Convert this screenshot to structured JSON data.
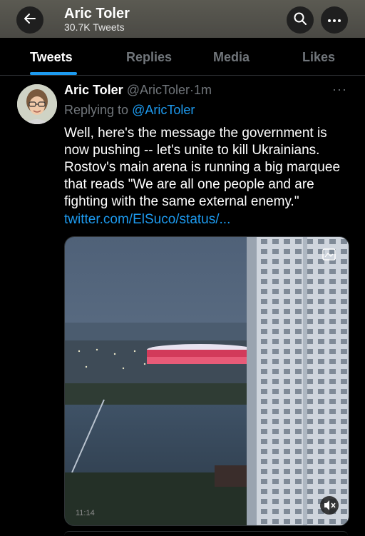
{
  "header": {
    "name": "Aric Toler",
    "count": "30.7K Tweets",
    "back_icon": "arrow-left-icon",
    "search_icon": "search-icon",
    "more_icon": "more-horizontal-icon"
  },
  "tabs": [
    {
      "label": "Tweets",
      "active": true
    },
    {
      "label": "Replies",
      "active": false
    },
    {
      "label": "Media",
      "active": false
    },
    {
      "label": "Likes",
      "active": false
    }
  ],
  "tweet": {
    "name": "Aric Toler",
    "handle": "@AricToler",
    "separator": "·",
    "time": "1m",
    "replying_prefix": "Replying to",
    "replying_handle": "@AricToler",
    "text": "Well, here's the message the government is now pushing -- let's unite to kill Ukrainians. Rostov's main arena is running a big marquee that reads \"We are all one people and are fighting with the same external enemy.\"",
    "link": "twitter.com/ElSuco/status/...",
    "media_timestamp": "11:14"
  },
  "colors": {
    "accent": "#1d9bf0",
    "muted": "#71767b",
    "background": "#000000"
  }
}
